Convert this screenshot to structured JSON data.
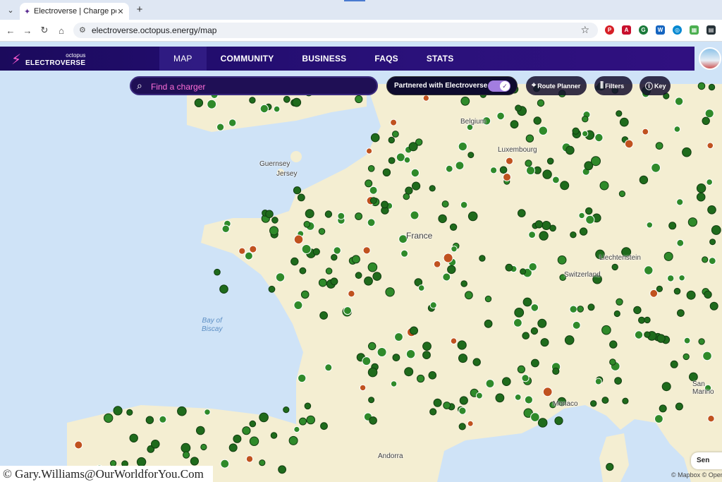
{
  "browser": {
    "tab_title": "Electroverse | Charge point ma",
    "tab_close": "✕",
    "new_tab": "+",
    "url": "electroverse.octopus.energy/map",
    "star": "☆"
  },
  "app": {
    "logo_top": "octopus",
    "logo_bottom": "ELECTROVERSE",
    "nav": [
      {
        "label": "MAP",
        "active": true
      },
      {
        "label": "COMMUNITY"
      },
      {
        "label": "BUSINESS"
      },
      {
        "label": "FAQS"
      },
      {
        "label": "STATS"
      }
    ],
    "search_placeholder": "Find a charger",
    "partner_label": "Partnered with Electroverse",
    "partner_toggle_on": true,
    "route_planner": "Route Planner",
    "filters": "Filters",
    "key": "Key"
  },
  "map": {
    "labels": {
      "belgium": "Belgium",
      "luxembourg": "Luxembourg",
      "guernsey": "Guernsey",
      "jersey": "Jersey",
      "france": "France",
      "liechtenstein": "Liechtenstein",
      "switzerland": "Switzerland",
      "bay_line1": "Bay of",
      "bay_line2": "Biscay",
      "monaco": "Monaco",
      "san_marino": "San Marino",
      "andorra": "Andorra"
    },
    "attribution": "© Mapbox © Open",
    "send_label": "Sen"
  },
  "watermark": "© Gary.Williams@OurWorldforYou.Com",
  "colors": {
    "nav_bg": "#220d6e",
    "accent_pink": "#ff5bd1",
    "land": "#f4eed2",
    "sea": "#cfe3f7",
    "marker_green": "#2f8a2a"
  }
}
